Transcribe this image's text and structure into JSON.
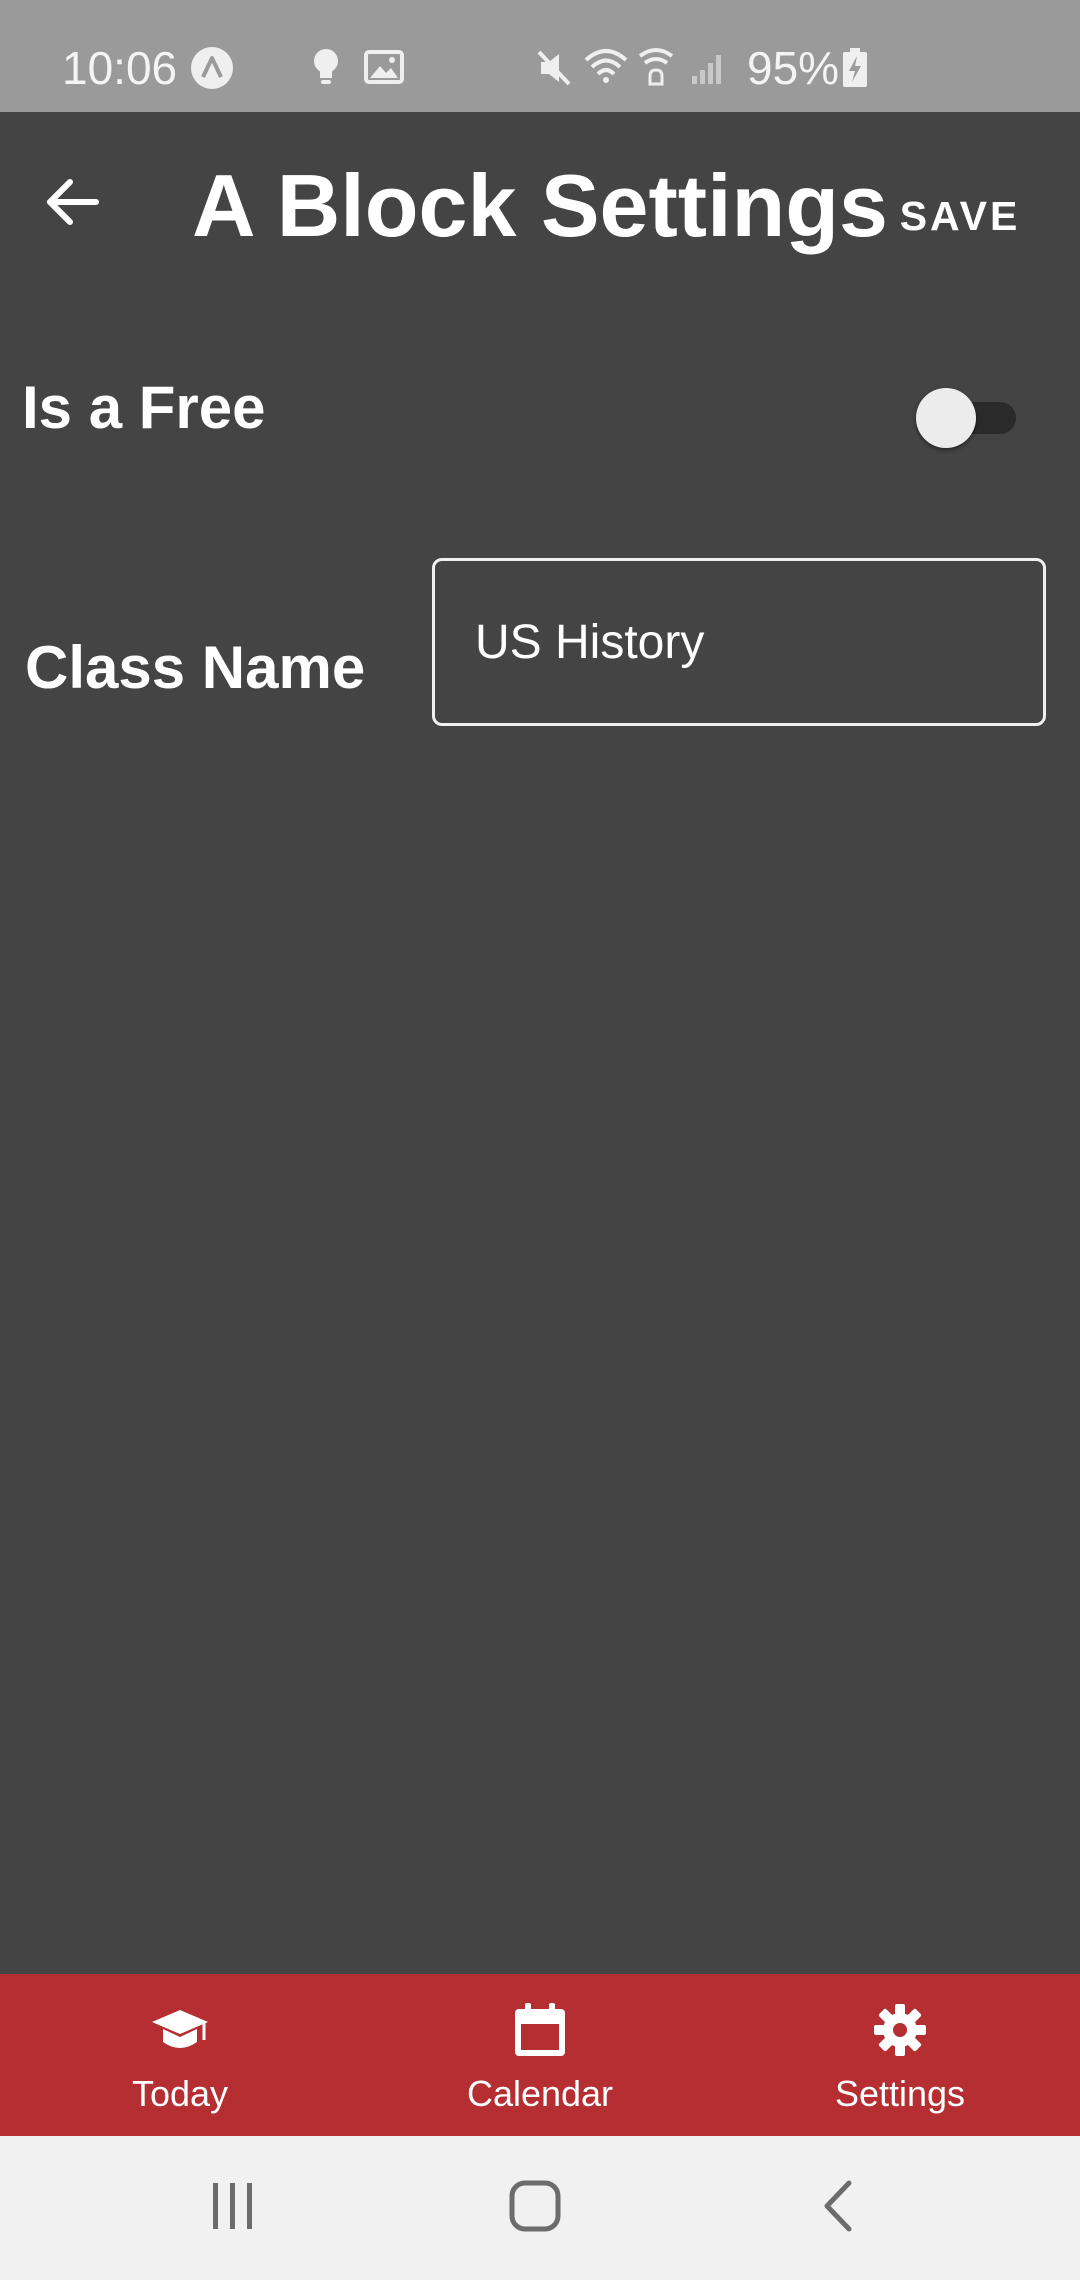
{
  "status_bar": {
    "time": "10:06",
    "battery": "95%",
    "icons": [
      "app-notification-icon",
      "lightbulb-icon",
      "image-icon",
      "mute-icon",
      "wifi-icon",
      "wifi-calling-icon",
      "signal-icon",
      "battery-charging-icon"
    ]
  },
  "header": {
    "title": "A Block Settings",
    "save_label": "SAVE",
    "back_icon": "arrow-left-icon"
  },
  "settings": {
    "free_label": "Is a Free",
    "free_enabled": false,
    "class_name_label": "Class Name",
    "class_name_value": "US History"
  },
  "bottom_nav": {
    "items": [
      {
        "label": "Today",
        "icon": "graduation-cap-icon"
      },
      {
        "label": "Calendar",
        "icon": "calendar-icon"
      },
      {
        "label": "Settings",
        "icon": "gear-icon"
      }
    ]
  },
  "colors": {
    "background": "#444444",
    "status_bar": "#9a9a9a",
    "nav_accent": "#b52e32",
    "system_nav": "#f1f1f1"
  }
}
